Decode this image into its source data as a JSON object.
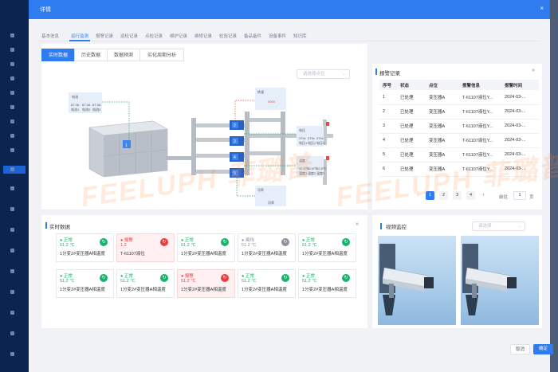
{
  "modal": {
    "title": "详情",
    "close_icon": "×"
  },
  "tabs_top": [
    "基本信息",
    "运行监测",
    "报警记录",
    "巡检记录",
    "点检记录",
    "维护记录",
    "维修记录",
    "检验记录",
    "备品备件",
    "设备事件",
    "知识库"
  ],
  "tabs_sub": [
    "实时数据",
    "历史数据",
    "数据预测",
    "劣化周期分析"
  ],
  "point_select": {
    "placeholder": "请选择点位"
  },
  "diagram": {
    "box_electric": "电流",
    "electric_vals": [
      "67.3A",
      "67.3A",
      "67.3A"
    ],
    "electric_sub": [
      "电流1",
      "电流2",
      "电流3"
    ],
    "box_speed": "转速",
    "speed_val": "0000",
    "box_voltage": "电压",
    "voltage_vals": [
      "379v",
      "379v",
      "379v"
    ],
    "voltage_sub": [
      "电压1",
      "电压2",
      "电压3"
    ],
    "box_temp": "温度",
    "temp_vals": [
      "42.8℃",
      "42.8℃",
      "42.8℃"
    ],
    "temp_sub": [
      "温度1",
      "温度2",
      "温度3"
    ],
    "box_power": "功率",
    "power_sub": "功率",
    "pumps": [
      "1",
      "2",
      "3",
      "4",
      "5"
    ]
  },
  "alarm": {
    "title": "报警记录",
    "more_icon": "»",
    "columns": [
      "序号",
      "状态",
      "点位",
      "报警信息",
      "报警时间"
    ],
    "rows": [
      [
        "1",
        "已处理",
        "变压器A",
        "T-61107液位Y...",
        "2024-03-..."
      ],
      [
        "2",
        "已处理",
        "变压器A",
        "T-61107液位Y...",
        "2024-03-..."
      ],
      [
        "3",
        "已处理",
        "变压器A",
        "T-61107液位Y...",
        "2024-03-..."
      ],
      [
        "4",
        "已处理",
        "变压器A",
        "T-61107液位Y...",
        "2024-03-..."
      ],
      [
        "5",
        "已处理",
        "变压器A",
        "T-61107液位Y...",
        "2024-03-..."
      ],
      [
        "6",
        "已处理",
        "变压器A",
        "T-61107液位Y...",
        "2024-03-..."
      ]
    ],
    "pager": {
      "prev": "‹",
      "pages": [
        "1",
        "2",
        "3",
        "4"
      ],
      "next": "›",
      "goto_label": "前往",
      "goto_value": "1",
      "page_unit": "页"
    }
  },
  "realtime": {
    "title": "实时数据",
    "more_icon": "»",
    "cards": [
      {
        "status": "● 正常",
        "value": "51.2 ℃",
        "label": "1分变2#变压器A相温度",
        "icon": "↻",
        "kind": "normal"
      },
      {
        "status": "● 报警",
        "value": "1.2",
        "label": "T-61107液位",
        "icon": "↻",
        "kind": "alarm"
      },
      {
        "status": "● 正常",
        "value": "51.2 ℃",
        "label": "1分变2#变压器A相温度",
        "icon": "↻",
        "kind": "normal"
      },
      {
        "status": "● 离线",
        "value": "51.2 ℃",
        "label": "1分变2#变压器A相温度",
        "icon": "↻",
        "kind": "offline"
      },
      {
        "status": "● 正常",
        "value": "51.2 ℃",
        "label": "1分变2#变压器A相温度",
        "icon": "↻",
        "kind": "normal"
      },
      {
        "status": "● 正常",
        "value": "51.2 ℃",
        "label": "1分变2#变压器A相温度",
        "icon": "↻",
        "kind": "normal"
      },
      {
        "status": "● 正常",
        "value": "51.2 ℃",
        "label": "1分变2#变压器A相温度",
        "icon": "↻",
        "kind": "normal"
      },
      {
        "status": "● 报警",
        "value": "51.2 ℃",
        "label": "1分变2#变压器A相温度",
        "icon": "↻",
        "kind": "alarm"
      },
      {
        "status": "● 正常",
        "value": "51.2 ℃",
        "label": "1分变2#变压器A相温度",
        "icon": "↻",
        "kind": "normal"
      },
      {
        "status": "● 正常",
        "value": "51.2 ℃",
        "label": "1分变2#变压器A相温度",
        "icon": "↻",
        "kind": "normal"
      }
    ]
  },
  "video": {
    "title": "视频监控",
    "select_placeholder": "请选择"
  },
  "footer": {
    "cancel": "取消",
    "confirm": "确定"
  },
  "watermark": "FEELUPH 菲璐普",
  "colors": {
    "primary": "#2f7cf0",
    "normal": "#19b36b",
    "alarm": "#ee3b3b",
    "offline": "#8d939c"
  }
}
